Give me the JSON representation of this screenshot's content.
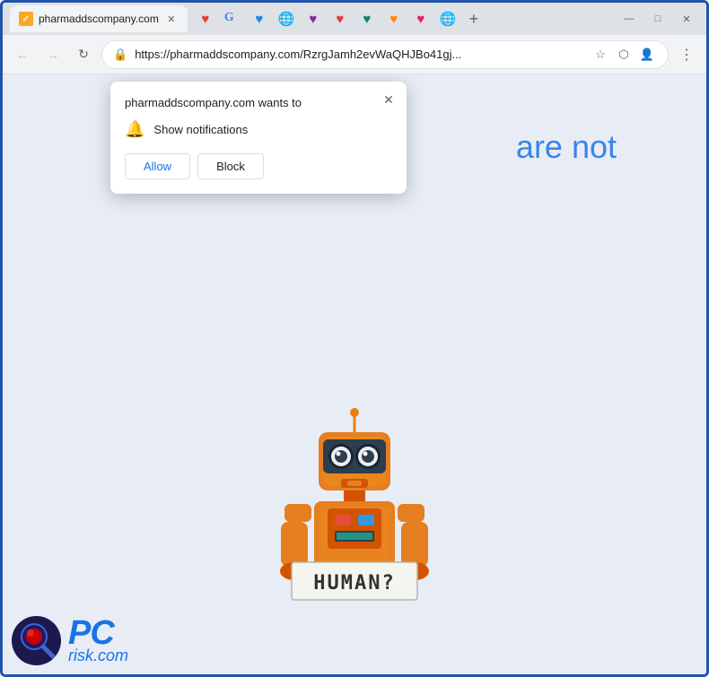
{
  "browser": {
    "title": "pharmaddscompany.com",
    "url": "https://pharmaddscompany.com/RzrgJamh2evWaQHJBo41gj...",
    "url_display": "https://pharmaddscompany.com/RzrgJamh2evWaQHJBo41gj..."
  },
  "tabs": [
    {
      "label": "pharmaddscompany.com",
      "favicon": "check",
      "active": true
    }
  ],
  "pinned_tabs": [
    {
      "icon": "heart-red"
    },
    {
      "icon": "g"
    },
    {
      "icon": "heart-blue"
    },
    {
      "icon": "globe"
    },
    {
      "icon": "heart-purple"
    },
    {
      "icon": "heart-red2"
    },
    {
      "icon": "heart-teal"
    },
    {
      "icon": "heart-orange"
    },
    {
      "icon": "heart-pink"
    },
    {
      "icon": "globe2"
    },
    {
      "icon": "plus"
    }
  ],
  "window_controls": {
    "minimize": "—",
    "maximize": "□",
    "close": "✕"
  },
  "nav": {
    "back_disabled": true,
    "forward_disabled": true
  },
  "permission_popup": {
    "title": "pharmaddscompany.com wants to",
    "close_label": "✕",
    "notification_label": "Show notifications",
    "allow_label": "Allow",
    "block_label": "Block"
  },
  "page": {
    "visible_text": "are not",
    "background_color": "#e8edf5"
  },
  "robot": {
    "sign_text": "HUMAN?"
  },
  "pcrisk": {
    "text": "PC",
    "subtext": "risk.com"
  }
}
